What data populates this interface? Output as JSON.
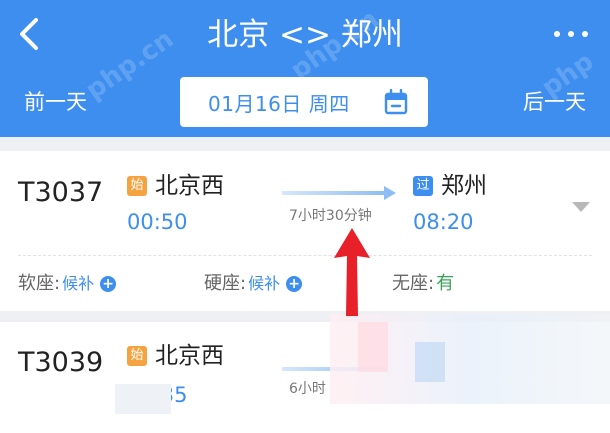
{
  "header": {
    "title": "北京 <> 郑州",
    "prev_day": "前一天",
    "next_day": "后一天",
    "date": "01月16日 周四"
  },
  "trains": [
    {
      "number": "T3037",
      "from_badge": "始",
      "from_station": "北京西",
      "depart_time": "00:50",
      "duration": "7小时30分钟",
      "to_badge": "过",
      "to_station": "郑州",
      "arrive_time": "08:20",
      "seats": [
        {
          "label": "软座:",
          "value": "候补"
        },
        {
          "label": "硬座:",
          "value": "候补"
        },
        {
          "label": "无座:",
          "value": "有"
        }
      ]
    },
    {
      "number": "T3039",
      "from_badge": "始",
      "from_station": "北京西",
      "depart_time": "00:35",
      "duration": "6小时"
    }
  ],
  "colors": {
    "accent": "#3e8ef0",
    "start_badge": "#f5a340",
    "available": "#3aa35a",
    "annotation": "#e8202a"
  },
  "icons": [
    "back-icon",
    "more-icon",
    "calendar-icon",
    "plus-icon",
    "chevron-down-icon"
  ]
}
